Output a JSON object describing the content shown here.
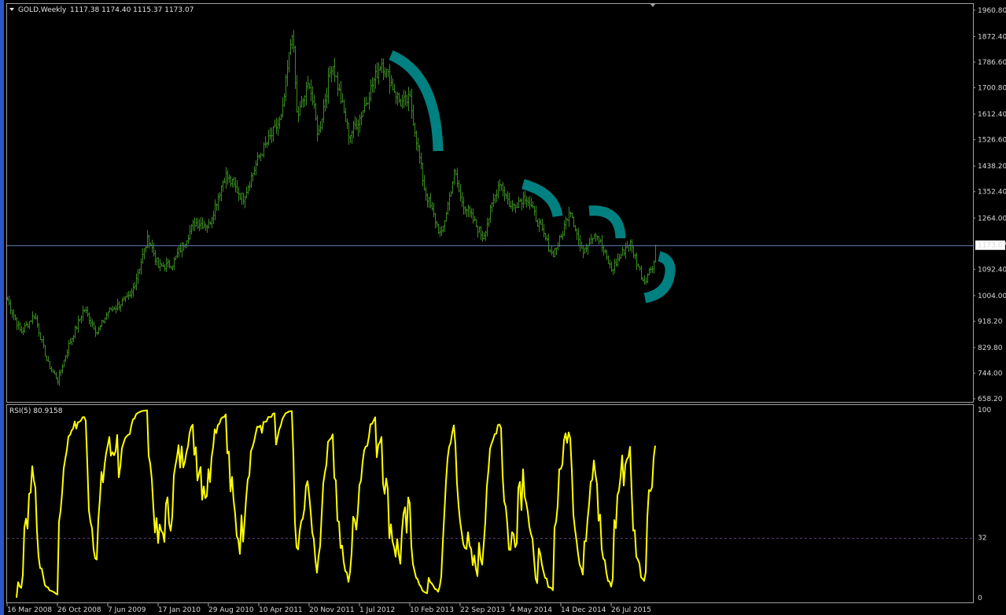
{
  "header": {
    "symbol": "GOLD,Weekly",
    "ohlc": "1117.38 1174.40 1115.37 1173.07"
  },
  "indicator": {
    "label": "RSI(5) 80.9158"
  },
  "colors": {
    "background": "#000000",
    "price_bars": "#3a8a20",
    "rsi_line": "#ffff00",
    "annotation": "#008080",
    "grid_frame": "#a0a0a0",
    "current_price_line": "#5a78a8",
    "rsi_level_line": "#5a3a78"
  },
  "current_price_label": "1173.07",
  "chart_data": [
    {
      "type": "bar",
      "symbol": "GOLD",
      "timeframe": "Weekly",
      "ylim": [
        658.2,
        1960.8
      ],
      "y_ticks": [
        "1960.80",
        "1872.40",
        "1786.60",
        "1700.80",
        "1612.40",
        "1526.60",
        "1438.20",
        "1352.40",
        "1264.00",
        "1173.07",
        "1092.40",
        "1004.00",
        "918.20",
        "829.80",
        "744.00",
        "658.20"
      ],
      "x_ticks": [
        "16 Mar 2008",
        "26 Oct 2008",
        "7 Jun 2009",
        "17 Jan 2010",
        "29 Aug 2010",
        "10 Apr 2011",
        "20 Nov 2011",
        "1 Jul 2012",
        "10 Feb 2013",
        "22 Sep 2013",
        "4 May 2014",
        "14 Dec 2014",
        "26 Jul 2015"
      ],
      "anchors": [
        [
          "2008-03-16",
          990
        ],
        [
          "2008-05-15",
          880
        ],
        [
          "2008-07-15",
          940
        ],
        [
          "2008-09-10",
          780
        ],
        [
          "2008-10-26",
          720
        ],
        [
          "2008-12-15",
          840
        ],
        [
          "2009-02-20",
          960
        ],
        [
          "2009-04-20",
          880
        ],
        [
          "2009-06-07",
          950
        ],
        [
          "2009-09-15",
          1000
        ],
        [
          "2009-12-03",
          1200
        ],
        [
          "2010-01-17",
          1100
        ],
        [
          "2010-03-20",
          1110
        ],
        [
          "2010-06-28",
          1250
        ],
        [
          "2010-08-29",
          1240
        ],
        [
          "2010-11-10",
          1410
        ],
        [
          "2011-01-28",
          1330
        ],
        [
          "2011-04-10",
          1470
        ],
        [
          "2011-07-20",
          1600
        ],
        [
          "2011-09-05",
          1900
        ],
        [
          "2011-09-26",
          1600
        ],
        [
          "2011-11-20",
          1720
        ],
        [
          "2011-12-29",
          1540
        ],
        [
          "2012-02-29",
          1790
        ],
        [
          "2012-05-15",
          1540
        ],
        [
          "2012-07-01",
          1600
        ],
        [
          "2012-10-05",
          1790
        ],
        [
          "2012-12-28",
          1650
        ],
        [
          "2013-02-10",
          1660
        ],
        [
          "2013-04-15",
          1360
        ],
        [
          "2013-06-28",
          1200
        ],
        [
          "2013-08-27",
          1420
        ],
        [
          "2013-09-22",
          1330
        ],
        [
          "2013-12-31",
          1200
        ],
        [
          "2014-03-15",
          1390
        ],
        [
          "2014-05-04",
          1300
        ],
        [
          "2014-07-10",
          1340
        ],
        [
          "2014-11-05",
          1140
        ],
        [
          "2014-12-14",
          1200
        ],
        [
          "2015-01-22",
          1300
        ],
        [
          "2015-03-15",
          1150
        ],
        [
          "2015-05-15",
          1220
        ],
        [
          "2015-07-26",
          1090
        ],
        [
          "2015-10-14",
          1185
        ],
        [
          "2015-12-17",
          1050
        ],
        [
          "2016-01-31",
          1117.38
        ],
        [
          "2016-02-07",
          1173.07
        ]
      ],
      "last_bar": {
        "open": 1117.38,
        "high": 1174.4,
        "low": 1115.37,
        "close": 1173.07
      }
    },
    {
      "type": "line",
      "indicator": "RSI(5)",
      "ylim": [
        0,
        100
      ],
      "y_ticks": [
        "100",
        "32",
        "0"
      ],
      "level": 32,
      "last_value": 80.9158,
      "x_ticks": [
        "16 Mar 2008",
        "26 Oct 2008",
        "7 Jun 2009",
        "17 Jan 2010",
        "29 Aug 2010",
        "10 Apr 2011",
        "20 Nov 2011",
        "1 Jul 2012",
        "10 Feb 2013",
        "22 Sep 2013",
        "4 May 2014",
        "14 Dec 2014",
        "26 Jul 2015"
      ]
    }
  ]
}
